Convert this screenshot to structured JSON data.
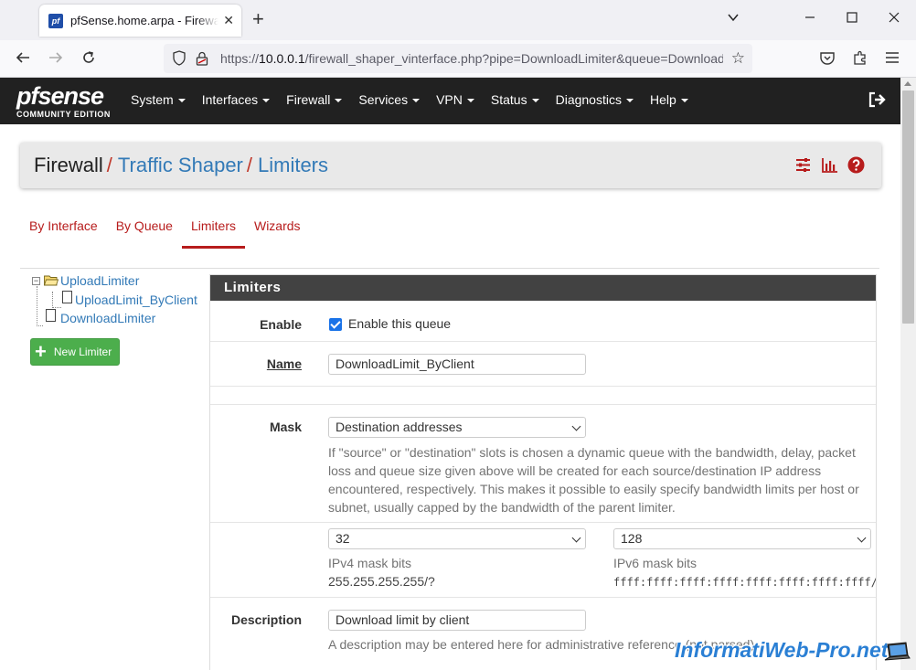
{
  "browser": {
    "tab_title": "pfSense.home.arpa - Firewall: Traffic Shaper",
    "url_prefix": "https://",
    "url_host": "10.0.0.1",
    "url_path": "/firewall_shaper_vinterface.php?pipe=DownloadLimiter&queue=DownloadLimit_ByClient"
  },
  "logo": {
    "brand": "pfsense",
    "edition": "COMMUNITY EDITION"
  },
  "menu": [
    "System",
    "Interfaces",
    "Firewall",
    "Services",
    "VPN",
    "Status",
    "Diagnostics",
    "Help"
  ],
  "breadcrumb": {
    "static": "Firewall",
    "sep": "/",
    "link1": "Traffic Shaper",
    "link2": "Limiters"
  },
  "tabs": [
    "By Interface",
    "By Queue",
    "Limiters",
    "Wizards"
  ],
  "tree": {
    "root": "UploadLimiter",
    "child": "UploadLimit_ByClient",
    "second": "DownloadLimiter"
  },
  "new_limiter_label": "New Limiter",
  "panel": {
    "title": "Limiters",
    "enable_label": "Enable",
    "enable_checkbox_label": "Enable this queue",
    "name_label": "Name",
    "name_value": "DownloadLimit_ByClient",
    "mask_label": "Mask",
    "mask_value": "Destination addresses",
    "mask_help": "If \"source\" or \"destination\" slots is chosen a dynamic queue with the bandwidth, delay, packet loss and queue size given above will be created for each source/destination IP address encountered, respectively. This makes it possible to easily specify bandwidth limits per host or subnet, usually capped by the bandwidth of the parent limiter.",
    "ipv4_value": "32",
    "ipv4_label": "IPv4 mask bits",
    "ipv4_mask": "255.255.255.255/?",
    "ipv6_value": "128",
    "ipv6_label": "IPv6 mask bits",
    "ipv6_mask": "ffff:ffff:ffff:ffff:ffff:ffff:ffff:ffff/?",
    "desc_label": "Description",
    "desc_value": "Download limit by client",
    "desc_help": "A description may be entered here for administrative reference (not parsed)."
  },
  "watermark": "InformatiWeb-Pro.net",
  "colors": {
    "accent_red": "#b71c1c",
    "link_blue": "#337ab7",
    "header_dark": "#212121",
    "success_green": "#4cae4c"
  }
}
